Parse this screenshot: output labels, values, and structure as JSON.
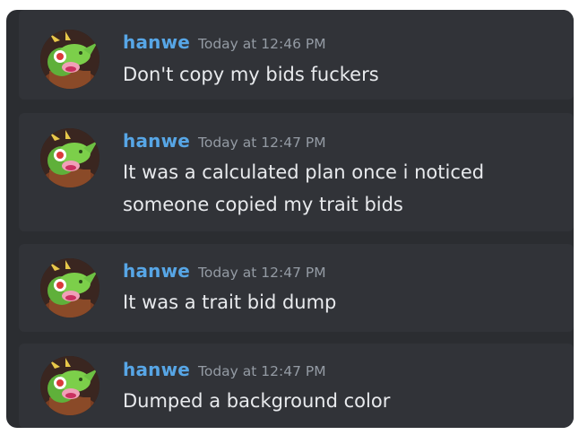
{
  "messages": [
    {
      "author": "hanwe",
      "timestamp": "Today at 12:46 PM",
      "lines": [
        "Don't copy my bids fuckers"
      ],
      "avatar_icon": "green-dragon-avatar-icon"
    },
    {
      "author": "hanwe",
      "timestamp": "Today at 12:47 PM",
      "lines": [
        "It was a calculated plan once i noticed",
        "someone copied my trait bids"
      ],
      "avatar_icon": "green-dragon-avatar-icon"
    },
    {
      "author": "hanwe",
      "timestamp": "Today at 12:47 PM",
      "lines": [
        "It was a trait bid dump"
      ],
      "avatar_icon": "green-dragon-avatar-icon"
    },
    {
      "author": "hanwe",
      "timestamp": "Today at 12:47 PM",
      "lines": [
        "Dumped a background color"
      ],
      "avatar_icon": "green-dragon-avatar-icon"
    }
  ],
  "colors": {
    "background": "#2b2d31",
    "message_background": "#313338",
    "author": "#57a6e6",
    "timestamp": "#949ba4",
    "text": "#e8eaed"
  }
}
